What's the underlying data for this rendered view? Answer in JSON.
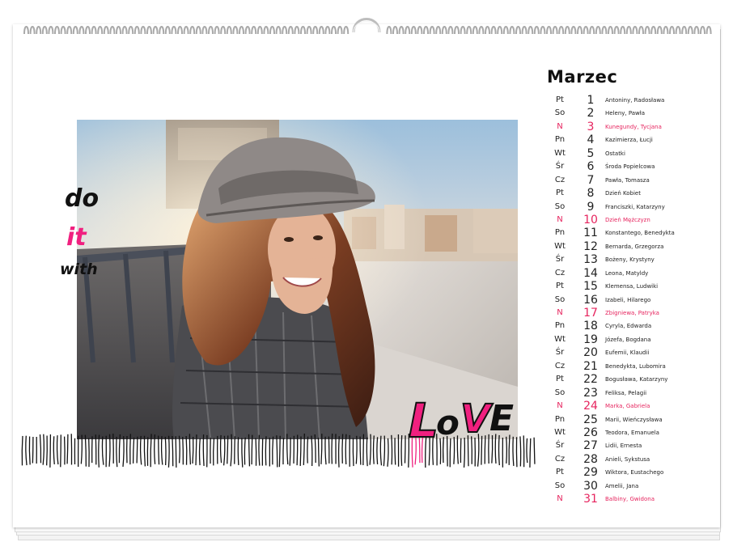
{
  "calendar": {
    "month": "Marzec",
    "deco_do": "do",
    "deco_it": "it",
    "deco_with": "with",
    "deco_love_l": "L",
    "deco_love_o": "o",
    "deco_love_v": "V",
    "deco_love_e": "E",
    "colors": {
      "accent": "#e6245e",
      "pink": "#f0207f",
      "text": "#222222"
    },
    "days": [
      {
        "dow": "Pt",
        "num": "1",
        "names": "Antoniny, Radosława"
      },
      {
        "dow": "So",
        "num": "2",
        "names": "Heleny, Pawła"
      },
      {
        "dow": "N",
        "num": "3",
        "names": "Kunegundy, Tycjana"
      },
      {
        "dow": "Pn",
        "num": "4",
        "names": "Kazimierza, Łucji"
      },
      {
        "dow": "Wt",
        "num": "5",
        "names": "Ostatki"
      },
      {
        "dow": "Śr",
        "num": "6",
        "names": "Środa Popielcowa"
      },
      {
        "dow": "Cz",
        "num": "7",
        "names": "Pawła, Tomasza"
      },
      {
        "dow": "Pt",
        "num": "8",
        "names": "Dzień Kobiet"
      },
      {
        "dow": "So",
        "num": "9",
        "names": "Franciszki, Katarzyny"
      },
      {
        "dow": "N",
        "num": "10",
        "names": "Dzień Mężczyzn"
      },
      {
        "dow": "Pn",
        "num": "11",
        "names": "Konstantego, Benedykta"
      },
      {
        "dow": "Wt",
        "num": "12",
        "names": "Bernarda, Grzegorza"
      },
      {
        "dow": "Śr",
        "num": "13",
        "names": "Bożeny, Krystyny"
      },
      {
        "dow": "Cz",
        "num": "14",
        "names": "Leona, Matyldy"
      },
      {
        "dow": "Pt",
        "num": "15",
        "names": "Klemensa, Ludwiki"
      },
      {
        "dow": "So",
        "num": "16",
        "names": "Izabeli, Hilarego"
      },
      {
        "dow": "N",
        "num": "17",
        "names": "Zbigniewa, Patryka"
      },
      {
        "dow": "Pn",
        "num": "18",
        "names": "Cyryla, Edwarda"
      },
      {
        "dow": "Wt",
        "num": "19",
        "names": "Józefa, Bogdana"
      },
      {
        "dow": "Śr",
        "num": "20",
        "names": "Eufemii, Klaudii"
      },
      {
        "dow": "Cz",
        "num": "21",
        "names": "Benedykta, Lubomira"
      },
      {
        "dow": "Pt",
        "num": "22",
        "names": "Bogusława, Katarzyny"
      },
      {
        "dow": "So",
        "num": "23",
        "names": "Feliksa, Pelagii"
      },
      {
        "dow": "N",
        "num": "24",
        "names": "Marka, Gabriela"
      },
      {
        "dow": "Pn",
        "num": "25",
        "names": "Marii, Wieńczysława"
      },
      {
        "dow": "Wt",
        "num": "26",
        "names": "Teodora, Emanuela"
      },
      {
        "dow": "Śr",
        "num": "27",
        "names": "Lidii, Ernesta"
      },
      {
        "dow": "Cz",
        "num": "28",
        "names": "Anieli, Sykstusa"
      },
      {
        "dow": "Pt",
        "num": "29",
        "names": "Wiktora, Eustachego"
      },
      {
        "dow": "So",
        "num": "30",
        "names": "Amelii, Jana"
      },
      {
        "dow": "N",
        "num": "31",
        "names": "Balbiny, Gwidona"
      }
    ]
  }
}
